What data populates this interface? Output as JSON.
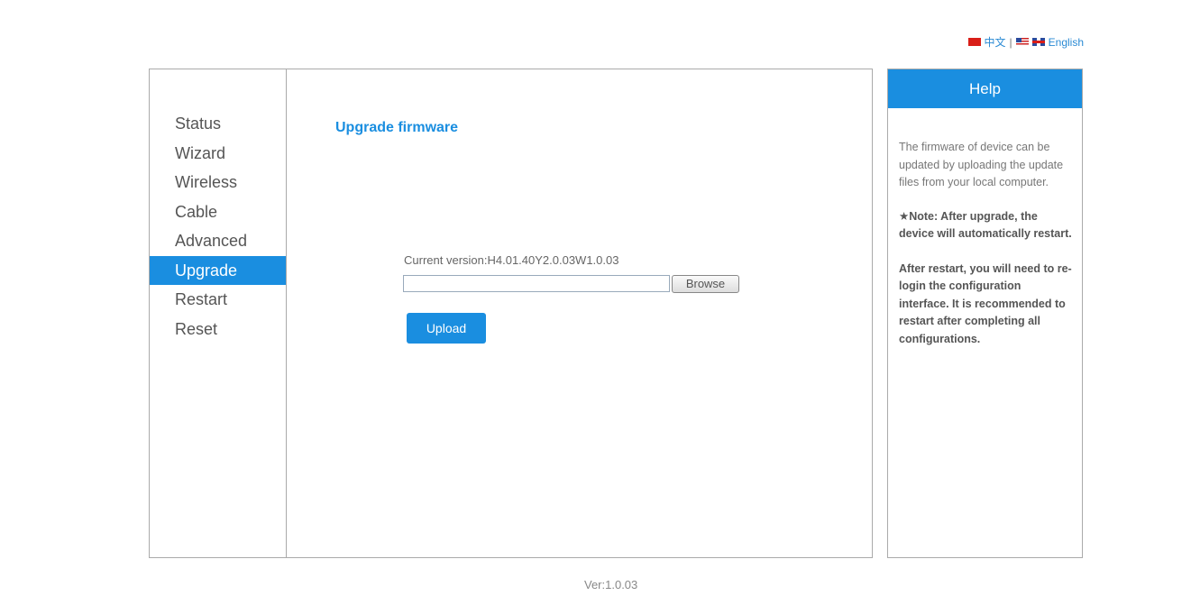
{
  "language": {
    "chinese_label": "中文",
    "separator": "|",
    "english_label": "English"
  },
  "sidebar": {
    "items": [
      {
        "label": "Status"
      },
      {
        "label": "Wizard"
      },
      {
        "label": "Wireless"
      },
      {
        "label": "Cable"
      },
      {
        "label": "Advanced"
      },
      {
        "label": "Upgrade",
        "active": true
      },
      {
        "label": "Restart"
      },
      {
        "label": "Reset"
      }
    ]
  },
  "main": {
    "title": "Upgrade firmware",
    "current_version": "Current version:H4.01.40Y2.0.03W1.0.03",
    "file_input_value": "",
    "browse_label": "Browse",
    "upload_label": "Upload"
  },
  "help": {
    "title": "Help",
    "description": "The firmware of device can be updated by uploading the update files from your local computer.",
    "note_star": "★",
    "note": "Note: After upgrade, the device will automatically restart.",
    "note2": "After restart, you will need to re-login the configuration interface. It is recommended to restart after completing all configurations."
  },
  "footer": {
    "version": "Ver:1.0.03"
  },
  "colors": {
    "accent": "#1a8ee0",
    "border": "#aaaaaa"
  },
  "icons": {
    "cn_flag": "china-flag-icon",
    "us_flag": "us-flag-icon",
    "uk_flag": "uk-flag-icon"
  }
}
